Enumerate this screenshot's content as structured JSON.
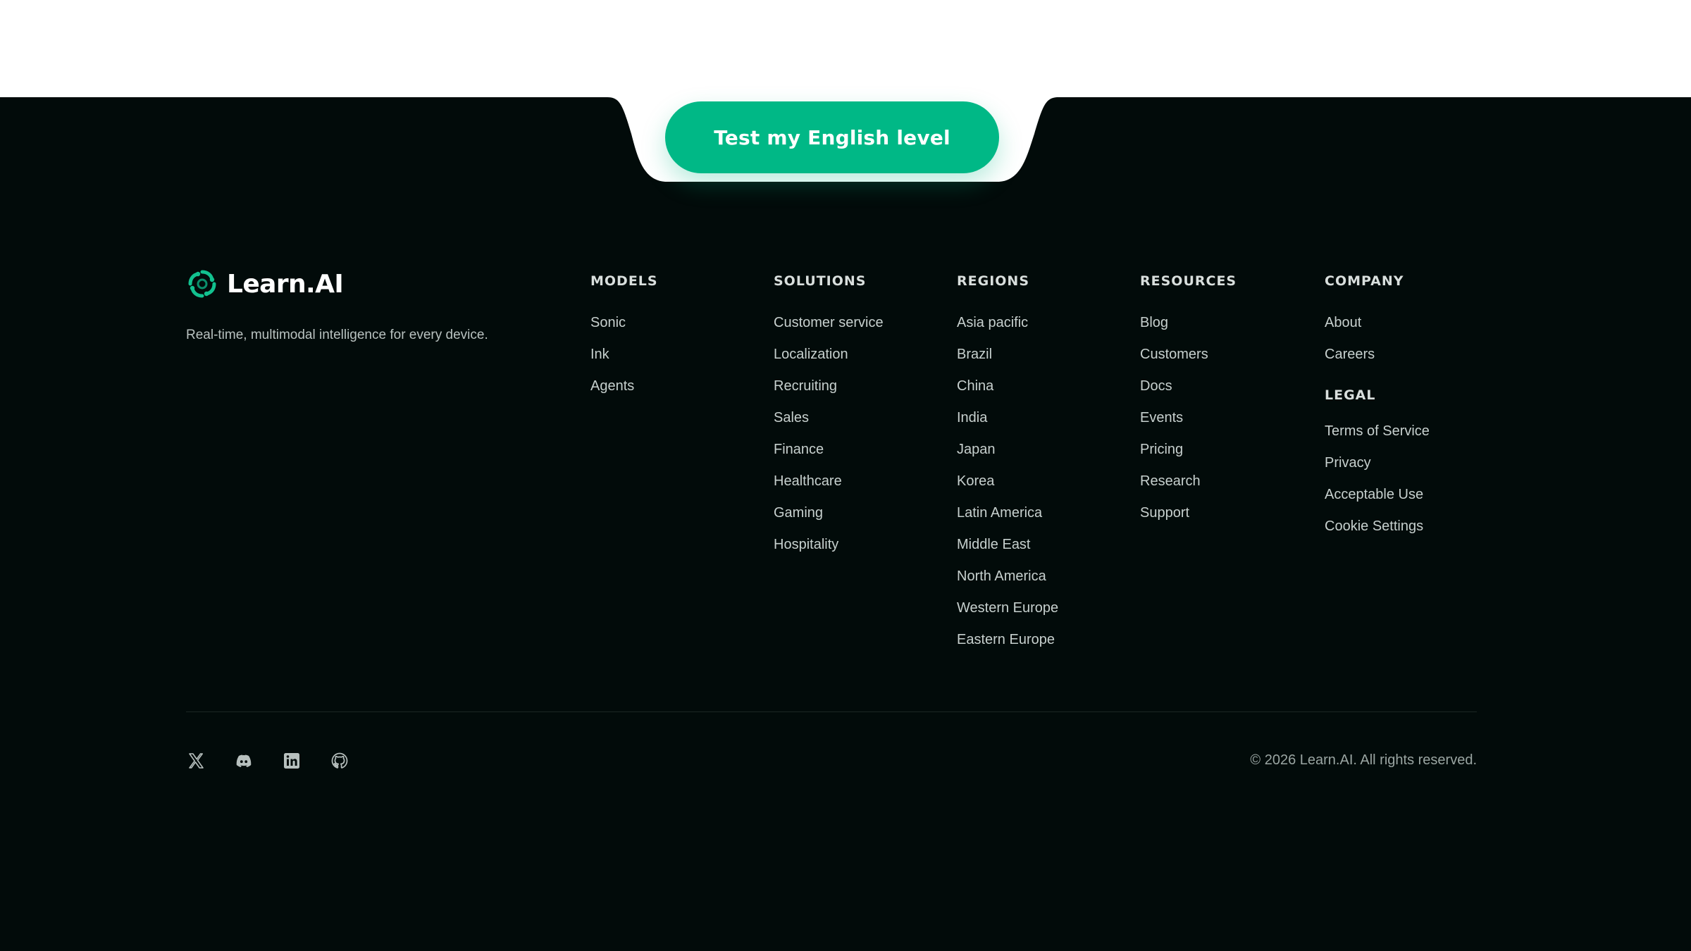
{
  "cta": {
    "label": "Test my English level"
  },
  "brand": {
    "name": "Learn.AI",
    "tagline": "Real-time, multimodal intelligence for every device.",
    "accent_color": "#00b886"
  },
  "columns": {
    "models": {
      "heading": "MODELS",
      "items": [
        "Sonic",
        "Ink",
        "Agents"
      ]
    },
    "solutions": {
      "heading": "SOLUTIONS",
      "items": [
        "Customer service",
        "Localization",
        "Recruiting",
        "Sales",
        "Finance",
        "Healthcare",
        "Gaming",
        "Hospitality"
      ]
    },
    "regions": {
      "heading": "REGIONS",
      "items": [
        "Asia pacific",
        "Brazil",
        "China",
        "India",
        "Japan",
        "Korea",
        "Latin America",
        "Middle East",
        "North America",
        "Western Europe",
        "Eastern Europe"
      ]
    },
    "resources": {
      "heading": "RESOURCES",
      "items": [
        "Blog",
        "Customers",
        "Docs",
        "Events",
        "Pricing",
        "Research",
        "Support"
      ]
    },
    "company": {
      "heading": "COMPANY",
      "items": [
        "About",
        "Careers"
      ]
    },
    "legal": {
      "heading": "LEGAL",
      "items": [
        "Terms of Service",
        "Privacy",
        "Acceptable Use",
        "Cookie Settings"
      ]
    }
  },
  "socials": [
    {
      "icon": "x-icon"
    },
    {
      "icon": "discord-icon"
    },
    {
      "icon": "linkedin-icon"
    },
    {
      "icon": "github-icon"
    }
  ],
  "copyright": "© 2026 Learn.AI. All rights reserved.",
  "colors": {
    "footer_bg": "#020b0a",
    "cta_bg": "#00b886"
  }
}
